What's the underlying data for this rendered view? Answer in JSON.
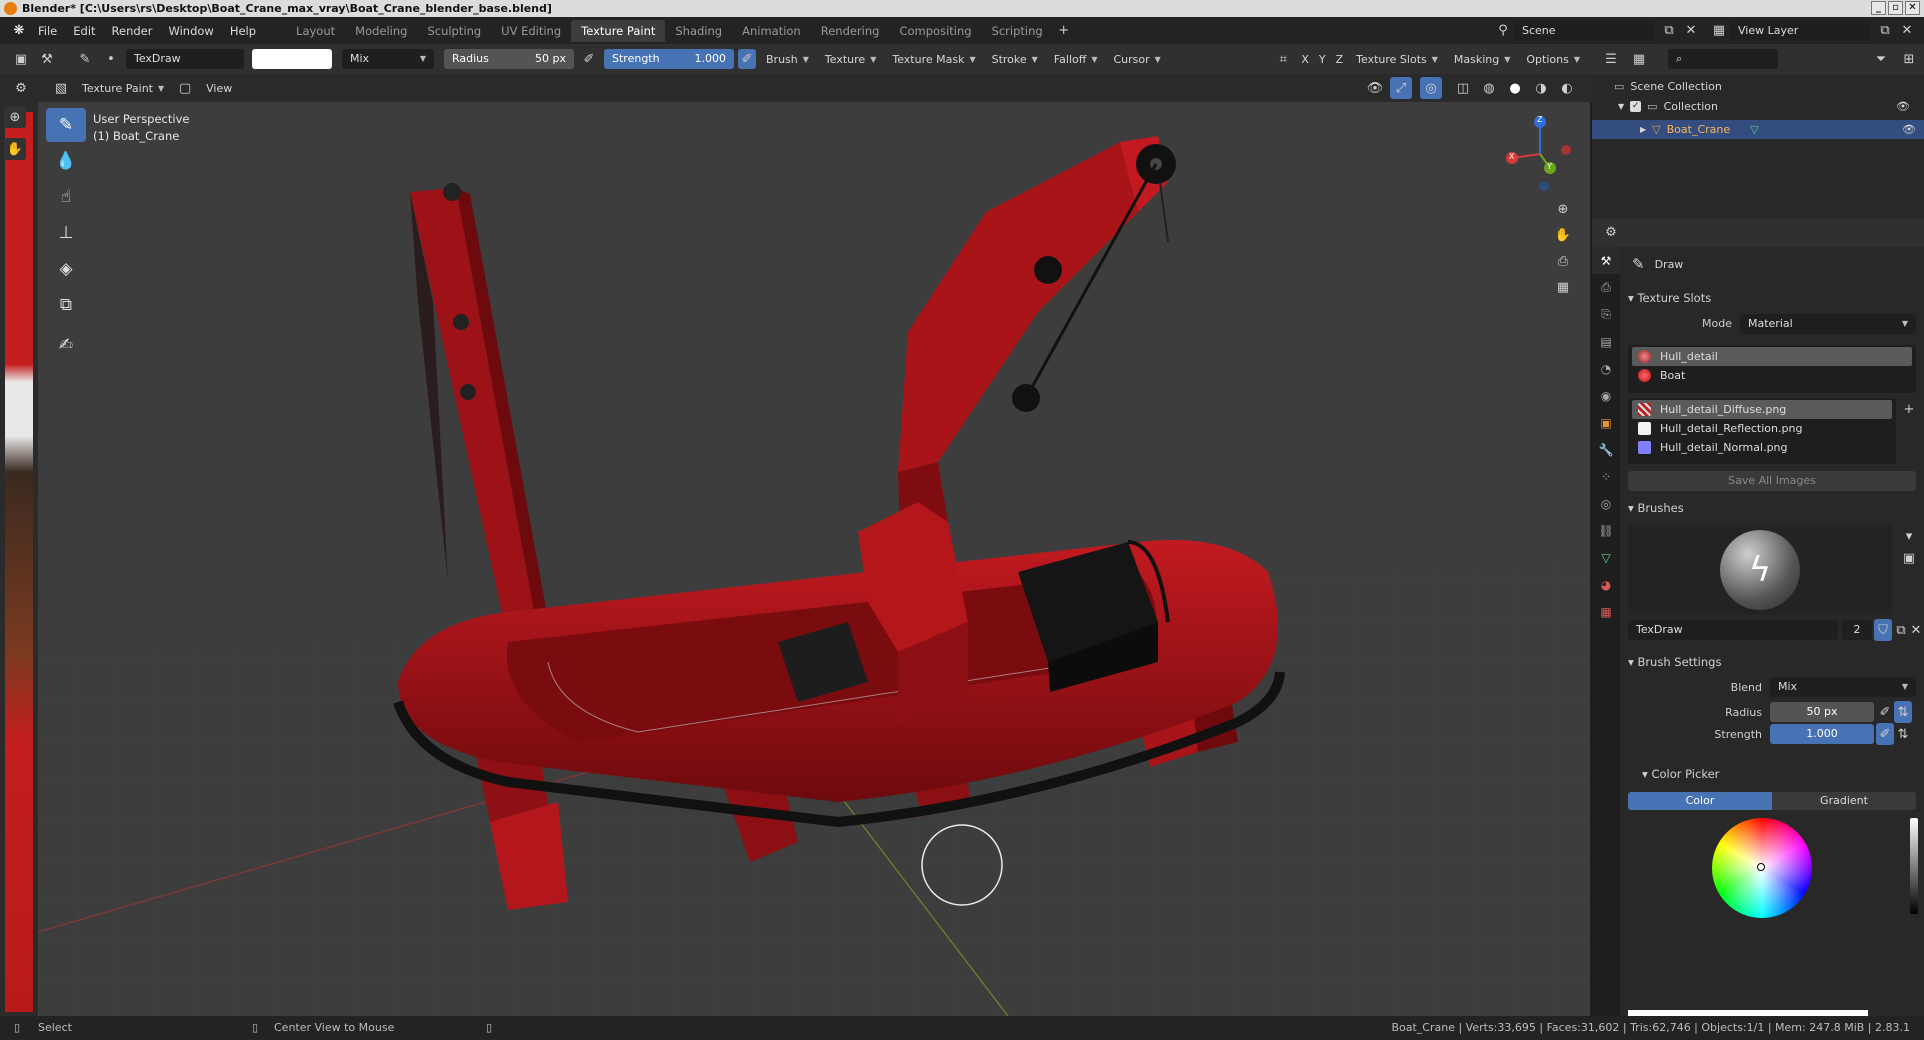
{
  "title": "Blender* [C:\\Users\\rs\\Desktop\\Boat_Crane_max_vray\\Boat_Crane_blender_base.blend]",
  "menu": [
    "File",
    "Edit",
    "Render",
    "Window",
    "Help"
  ],
  "workspaces": [
    "Layout",
    "Modeling",
    "Sculpting",
    "UV Editing",
    "Texture Paint",
    "Shading",
    "Animation",
    "Rendering",
    "Compositing",
    "Scripting"
  ],
  "active_workspace": "Texture Paint",
  "scene": "Scene",
  "view_layer": "View Layer",
  "toolhdr": {
    "brush_name": "TexDraw",
    "blend": "Mix",
    "radius_label": "Radius",
    "radius_value": "50 px",
    "strength_label": "Strength",
    "strength_value": "1.000",
    "menus": [
      "Brush",
      "Texture",
      "Texture Mask",
      "Stroke",
      "Falloff",
      "Cursor"
    ],
    "axes": [
      "X",
      "Y",
      "Z"
    ],
    "right_menus": [
      "Texture Slots",
      "Masking",
      "Options"
    ]
  },
  "viewhdr": {
    "mode": "Texture Paint",
    "view": "View"
  },
  "viewport": {
    "perspective": "User Perspective",
    "object": "(1) Boat_Crane",
    "gizmo": {
      "x": "X",
      "y": "Y",
      "z": "Z"
    }
  },
  "outliner": {
    "root": "Scene Collection",
    "collection": "Collection",
    "object": "Boat_Crane"
  },
  "props": {
    "tool_title": "Draw",
    "texture_slots": {
      "header": "Texture Slots",
      "mode_label": "Mode",
      "mode_value": "Material",
      "materials": [
        "Hull_detail",
        "Boat"
      ],
      "images": [
        "Hull_detail_Diffuse.png",
        "Hull_detail_Reflection.png",
        "Hull_detail_Normal.png"
      ],
      "save_all": "Save All Images"
    },
    "brushes": {
      "header": "Brushes",
      "name": "TexDraw",
      "users": "2"
    },
    "brush_settings": {
      "header": "Brush Settings",
      "blend_label": "Blend",
      "blend_value": "Mix",
      "radius_label": "Radius",
      "radius_value": "50 px",
      "strength_label": "Strength",
      "strength_value": "1.000"
    },
    "color_picker": {
      "header": "Color Picker",
      "tab_color": "Color",
      "tab_gradient": "Gradient"
    }
  },
  "status": {
    "left": "Select",
    "mid": "Center View to Mouse",
    "right": "Boat_Crane | Verts:33,695 | Faces:31,602 | Tris:62,746 | Objects:1/1 | Mem: 247.8 MiB | 2.83.1"
  },
  "colors": {
    "accent": "#4772b3",
    "boat_red": "#b3161b",
    "selection": "#334d80"
  }
}
